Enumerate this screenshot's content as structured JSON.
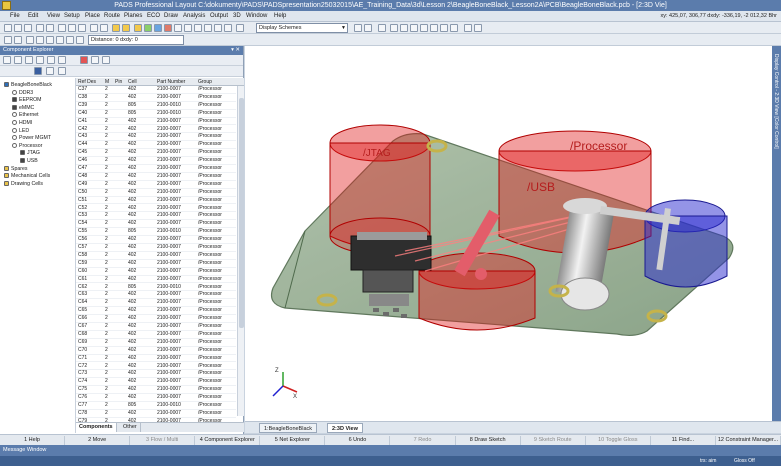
{
  "window": {
    "title": "PADS Professional Layout  C:\\dokumenty\\PADS\\PADSpresentation25032015\\AE_Training_Data\\3d\\Lesson 2\\BeagleBoneBlack_Lesson2A\\PCB\\BeagleBoneBlack.pcb - [2:3D Vie]"
  },
  "menu": {
    "items": [
      "File",
      "Edit",
      "View",
      "Setup",
      "Place",
      "Route",
      "Planes",
      "ECO",
      "Draw",
      "Analysis",
      "Output",
      "3D",
      "Window",
      "Help"
    ],
    "coords": "xy: 425,07, 306,77 dxdy: -336,19, -2 012,32 Bhr"
  },
  "toolbar": {
    "display_schemes": "Display Schemes",
    "distance": "Distance: 0 dxdy: 0"
  },
  "panel": {
    "title": "Component Explorer",
    "pin_icons": "▾ ✕"
  },
  "tree": {
    "nodes": [
      {
        "label": "BeagleBoneBlack",
        "indent": 0,
        "kind": "board"
      },
      {
        "label": "DDR3",
        "indent": 1,
        "kind": "circle"
      },
      {
        "label": "EEPROM",
        "indent": 1,
        "kind": "chip"
      },
      {
        "label": "eMMC",
        "indent": 1,
        "kind": "chip"
      },
      {
        "label": "Ethernet",
        "indent": 1,
        "kind": "circle"
      },
      {
        "label": "HDMI",
        "indent": 1,
        "kind": "circle"
      },
      {
        "label": "LED",
        "indent": 1,
        "kind": "circle"
      },
      {
        "label": "Power MGMT",
        "indent": 1,
        "kind": "circle"
      },
      {
        "label": "Processor",
        "indent": 1,
        "kind": "circle"
      },
      {
        "label": "JTAG",
        "indent": 2,
        "kind": "chip"
      },
      {
        "label": "USB",
        "indent": 2,
        "kind": "chip"
      },
      {
        "label": "Spares",
        "indent": 0,
        "kind": "folder"
      },
      {
        "label": "Mechanical Cells",
        "indent": 0,
        "kind": "folder"
      },
      {
        "label": "Drawing Cells",
        "indent": 0,
        "kind": "folder"
      }
    ]
  },
  "table": {
    "headers": [
      "Ref Des",
      "M",
      "Pin",
      "Cell",
      "Part Number",
      "Group"
    ],
    "rows": [
      [
        "C37",
        "2",
        "402",
        "2100-0007",
        "/Processor"
      ],
      [
        "C38",
        "2",
        "402",
        "2100-0007",
        "/Processor"
      ],
      [
        "C39",
        "2",
        "805",
        "2100-0010",
        "/Processor"
      ],
      [
        "C40",
        "2",
        "805",
        "2100-0010",
        "/Processor"
      ],
      [
        "C41",
        "2",
        "402",
        "2100-0007",
        "/Processor"
      ],
      [
        "C42",
        "2",
        "402",
        "2100-0007",
        "/Processor"
      ],
      [
        "C43",
        "2",
        "402",
        "2100-0007",
        "/Processor"
      ],
      [
        "C44",
        "2",
        "402",
        "2100-0007",
        "/Processor"
      ],
      [
        "C45",
        "2",
        "402",
        "2100-0007",
        "/Processor"
      ],
      [
        "C46",
        "2",
        "402",
        "2100-0007",
        "/Processor"
      ],
      [
        "C47",
        "2",
        "402",
        "2100-0007",
        "/Processor"
      ],
      [
        "C48",
        "2",
        "402",
        "2100-0007",
        "/Processor"
      ],
      [
        "C49",
        "2",
        "402",
        "2100-0007",
        "/Processor"
      ],
      [
        "C50",
        "2",
        "402",
        "2100-0007",
        "/Processor"
      ],
      [
        "C51",
        "2",
        "402",
        "2100-0007",
        "/Processor"
      ],
      [
        "C52",
        "2",
        "402",
        "2100-0007",
        "/Processor"
      ],
      [
        "C53",
        "2",
        "402",
        "2100-0007",
        "/Processor"
      ],
      [
        "C54",
        "2",
        "402",
        "2100-0007",
        "/Processor"
      ],
      [
        "C55",
        "2",
        "805",
        "2100-0010",
        "/Processor"
      ],
      [
        "C56",
        "2",
        "402",
        "2100-0007",
        "/Processor"
      ],
      [
        "C57",
        "2",
        "402",
        "2100-0007",
        "/Processor"
      ],
      [
        "C58",
        "2",
        "402",
        "2100-0007",
        "/Processor"
      ],
      [
        "C59",
        "2",
        "402",
        "2100-0007",
        "/Processor"
      ],
      [
        "C60",
        "2",
        "402",
        "2100-0007",
        "/Processor"
      ],
      [
        "C61",
        "2",
        "402",
        "2100-0007",
        "/Processor"
      ],
      [
        "C62",
        "2",
        "805",
        "2100-0010",
        "/Processor"
      ],
      [
        "C63",
        "2",
        "402",
        "2100-0007",
        "/Processor"
      ],
      [
        "C64",
        "2",
        "402",
        "2100-0007",
        "/Processor"
      ],
      [
        "C65",
        "2",
        "402",
        "2100-0007",
        "/Processor"
      ],
      [
        "C66",
        "2",
        "402",
        "2100-0007",
        "/Processor"
      ],
      [
        "C67",
        "2",
        "402",
        "2100-0007",
        "/Processor"
      ],
      [
        "C68",
        "2",
        "402",
        "2100-0007",
        "/Processor"
      ],
      [
        "C69",
        "2",
        "402",
        "2100-0007",
        "/Processor"
      ],
      [
        "C70",
        "2",
        "402",
        "2100-0007",
        "/Processor"
      ],
      [
        "C71",
        "2",
        "402",
        "2100-0007",
        "/Processor"
      ],
      [
        "C72",
        "2",
        "402",
        "2100-0007",
        "/Processor"
      ],
      [
        "C73",
        "2",
        "402",
        "2100-0007",
        "/Processor"
      ],
      [
        "C74",
        "2",
        "402",
        "2100-0007",
        "/Processor"
      ],
      [
        "C75",
        "2",
        "402",
        "2100-0007",
        "/Processor"
      ],
      [
        "C76",
        "2",
        "402",
        "2100-0007",
        "/Processor"
      ],
      [
        "C77",
        "2",
        "805",
        "2100-0010",
        "/Processor"
      ],
      [
        "C78",
        "2",
        "402",
        "2100-0007",
        "/Processor"
      ],
      [
        "C79",
        "2",
        "402",
        "2100-0007",
        "/Processor"
      ],
      [
        "C80",
        "2",
        "402",
        "2100-0007",
        "/Processor"
      ],
      [
        "C81",
        "2",
        "402",
        "2100-0007",
        "/Processor"
      ]
    ]
  },
  "bottom_tabs": [
    "Components",
    "Other"
  ],
  "view_tabs": [
    "1:BeagleBoneBlack",
    "2:3D View"
  ],
  "right_panel": "Display Control - 2:3D View [Color Control]",
  "viewport": {
    "label_processor": "/Processor",
    "label_usb": "/USB",
    "label_jtag": "/JTAG"
  },
  "fkeys": [
    "1 Help",
    "2 Move",
    "3 Flow / Multi",
    "4 Component Explorer",
    "5 Net Explorer",
    "6 Undo",
    "7 Redo",
    "8 Draw Sketch",
    "9 Sketch Route",
    "10 Toggle Gloss",
    "11 Find...",
    "12 Constraint Manager..."
  ],
  "message_window": "Message Window",
  "status": {
    "mode": "trs: aim",
    "gloss": "Gloss Off"
  },
  "colors": {
    "accent": "#5b7cac",
    "board": "#8fa88a",
    "red": "#e01a1a",
    "blue": "#2a2ad0"
  }
}
